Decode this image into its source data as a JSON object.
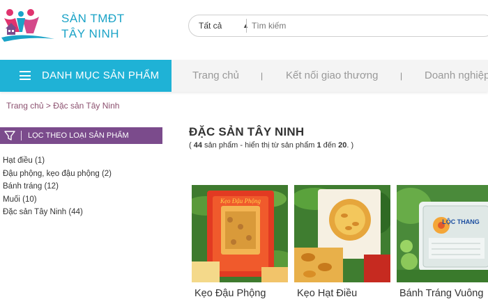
{
  "brand": {
    "line1": "SÀN TMĐT",
    "line2": "TÂY NINH"
  },
  "search": {
    "category": "Tất cả",
    "placeholder": "Tìm kiếm"
  },
  "nav": {
    "category_button": "DANH MỤC SẢN PHẨM",
    "items": [
      {
        "label": "Trang chủ"
      },
      {
        "label": "Kết nối giao thương"
      },
      {
        "label": "Doanh nghiệp"
      }
    ],
    "separator": "|"
  },
  "breadcrumb": {
    "home": "Trang chủ",
    "sep": " > ",
    "current": "Đặc sản Tây Ninh"
  },
  "filter": {
    "title": "LỌC THEO LOẠI SẢN PHẨM",
    "items": [
      {
        "label": "Hạt điều (1)"
      },
      {
        "label": "Đậu phộng, kẹo đậu phộng (2)"
      },
      {
        "label": "Bánh tráng (12)"
      },
      {
        "label": "Muối (10)"
      },
      {
        "label": "Đặc sản Tây Ninh (44)"
      }
    ]
  },
  "main": {
    "title": "ĐẶC SẢN TÂY NINH",
    "summary": {
      "open": "( ",
      "total": "44",
      "mid": " sản phẩm - hiển thị từ sản phẩm ",
      "from": "1",
      "to_word": " đến ",
      "to": "20",
      "close": ". )"
    },
    "products": [
      {
        "name": "Kẹo Đậu Phộng",
        "package_text": "Kẹo Đậu Phộng"
      },
      {
        "name": "Kẹo Hạt Điều"
      },
      {
        "name": "Bánh Tráng Vuông",
        "package_text": "LỘC THANG"
      }
    ]
  },
  "colors": {
    "accent": "#1fb2d6",
    "filter": "#7b4b8c",
    "breadcrumb": "#8b4f6e",
    "logo_pink": "#e0336e",
    "logo_teal": "#1aa3c7"
  }
}
